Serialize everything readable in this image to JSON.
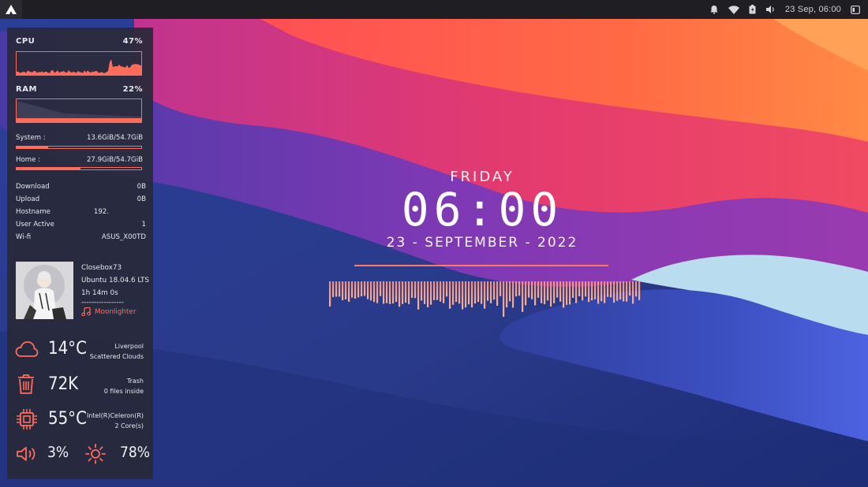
{
  "topbar": {
    "datetime": "23 Sep, 06:00",
    "icons": [
      "logo-icon",
      "bell-icon",
      "wifi-icon",
      "battery-icon",
      "volume-icon",
      "panel-icon"
    ]
  },
  "colors": {
    "accent": "#ff6d5a",
    "panel_bg": "#282a3a",
    "text": "#e6e6ee"
  },
  "conky": {
    "cpu_label": "CPU",
    "cpu_percent": "47%",
    "ram_label": "RAM",
    "ram_percent": "22%",
    "system_label": "System :",
    "system_value": "13.6GiB/54.7GiB",
    "system_fraction": 0.25,
    "home_label": "Home :",
    "home_value": "27.9GiB/54.7GiB",
    "home_fraction": 0.51,
    "download_label": "Download",
    "download_value": "0B",
    "upload_label": "Upload",
    "upload_value": "0B",
    "hostname_label": "Hostname",
    "hostname_value": "192.",
    "users_label": "User Active",
    "users_value": "1",
    "wifi_label": "Wi-fi",
    "wifi_value": "ASUS_X00TD",
    "user": "Closebox73",
    "os": "Ubuntu 18.04.6 LTS",
    "uptime": "1h 14m 0s",
    "separator": "-----------------",
    "song": "Moonlighter",
    "weather_temp": "14°C",
    "weather_city": "Liverpool",
    "weather_desc": "Scattered Clouds",
    "trash_size": "72K",
    "trash_label": "Trash",
    "trash_desc": "0 files inside",
    "cpu_temp": "55°C",
    "cpu_model": "Intel(R)Celeron(R)",
    "cpu_cores": "2 Core(s)",
    "volume": "3%",
    "brightness": "78%"
  },
  "clock": {
    "day": "FRIDAY",
    "time": "06:00",
    "date": "23 - SEPTEMBER - 2022"
  }
}
